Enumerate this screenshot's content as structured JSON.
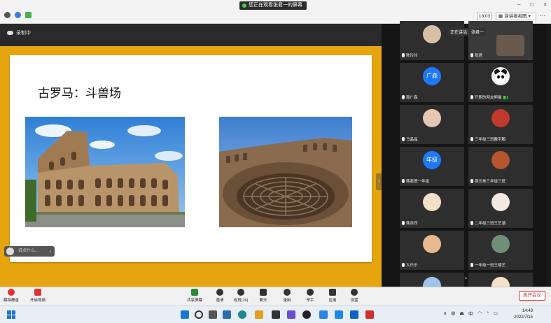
{
  "titlebar": {
    "share_banner": "您正在观看张君一的屏幕",
    "clock": "18:03",
    "view_label": "演讲者视图",
    "controls": [
      "–",
      "□",
      "×"
    ]
  },
  "share": {
    "recording_label": "录制中",
    "slide_title": "古罗马：斗兽场",
    "chat_placeholder": "说点什么..."
  },
  "speaker": {
    "label": "正在讲话：张君一"
  },
  "participants": [
    {
      "name": "陈玲玲",
      "avatar_text": ""
    },
    {
      "name": "张君",
      "avatar_text": ""
    },
    {
      "name": "周广森",
      "avatar_text": "广森"
    },
    {
      "name": "开朗的网友熊猫",
      "avatar_text": ""
    },
    {
      "name": "马晶晶",
      "avatar_text": ""
    },
    {
      "name": "三年级三班戴宇鹏",
      "avatar_text": ""
    },
    {
      "name": "韩若萱一年级",
      "avatar_text": "年级"
    },
    {
      "name": "周元美三年级三班",
      "avatar_text": ""
    },
    {
      "name": "韩泽西",
      "avatar_text": ""
    },
    {
      "name": "二年级三班王艺涵",
      "avatar_text": ""
    },
    {
      "name": "大乐乐",
      "avatar_text": ""
    },
    {
      "name": "一年级一班王楠艺",
      "avatar_text": ""
    }
  ],
  "toolbar": {
    "buttons": [
      "解除静音",
      "开启视频",
      "共享屏幕",
      "邀请",
      "成员(16)",
      "聊天",
      "录制",
      "举手",
      "应用",
      "设置"
    ],
    "leave_label": "离开会议"
  },
  "taskbar": {
    "tray": [
      "∧",
      "中"
    ],
    "time": "14:48",
    "date": "2022/7/15"
  },
  "colors": {
    "slide_border": "#e6a40e",
    "leave_red": "#dd3333",
    "accent_blue": "#1e78ff"
  }
}
